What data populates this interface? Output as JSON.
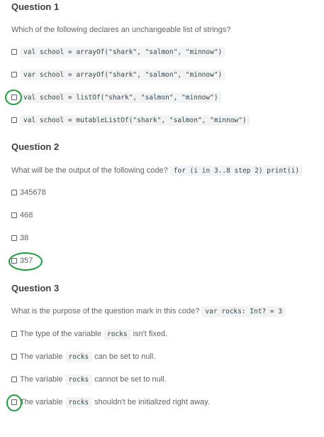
{
  "q1": {
    "title": "Question 1",
    "prompt": "Which of the following declares an unchangeable list of strings?",
    "options": [
      "val school = arrayOf(\"shark\", \"salmon\", \"minnow\")",
      "var school = arrayOf(\"shark\", \"salmon\", \"minnow\")",
      "val school = listOf(\"shark\", \"salmon\", \"minnow\")",
      "val school = mutableListOf(\"shark\", \"salmon\", \"minnow\")"
    ]
  },
  "q2": {
    "title": "Question 2",
    "prompt": "What will be the output of the following code?",
    "code": "for (i in 3..8 step 2) print(i)",
    "options": [
      "345678",
      "468",
      "38",
      "357"
    ]
  },
  "q3": {
    "title": "Question 3",
    "prompt": "What is the purpose of the question mark in this code?",
    "code": "var rocks: Int? = 3",
    "options": [
      {
        "pre": "The type of the variable",
        "code": "rocks",
        "post": "isn't fixed."
      },
      {
        "pre": "The variable",
        "code": "rocks",
        "post": "can be set to null."
      },
      {
        "pre": "The variable",
        "code": "rocks",
        "post": "cannot be set to null."
      },
      {
        "pre": "The variable",
        "code": "rocks",
        "post": "shouldn't be initialized right away."
      }
    ]
  },
  "colors": {
    "answer_mark": "#1f9d3a",
    "code_background": "#f1f3f4"
  }
}
